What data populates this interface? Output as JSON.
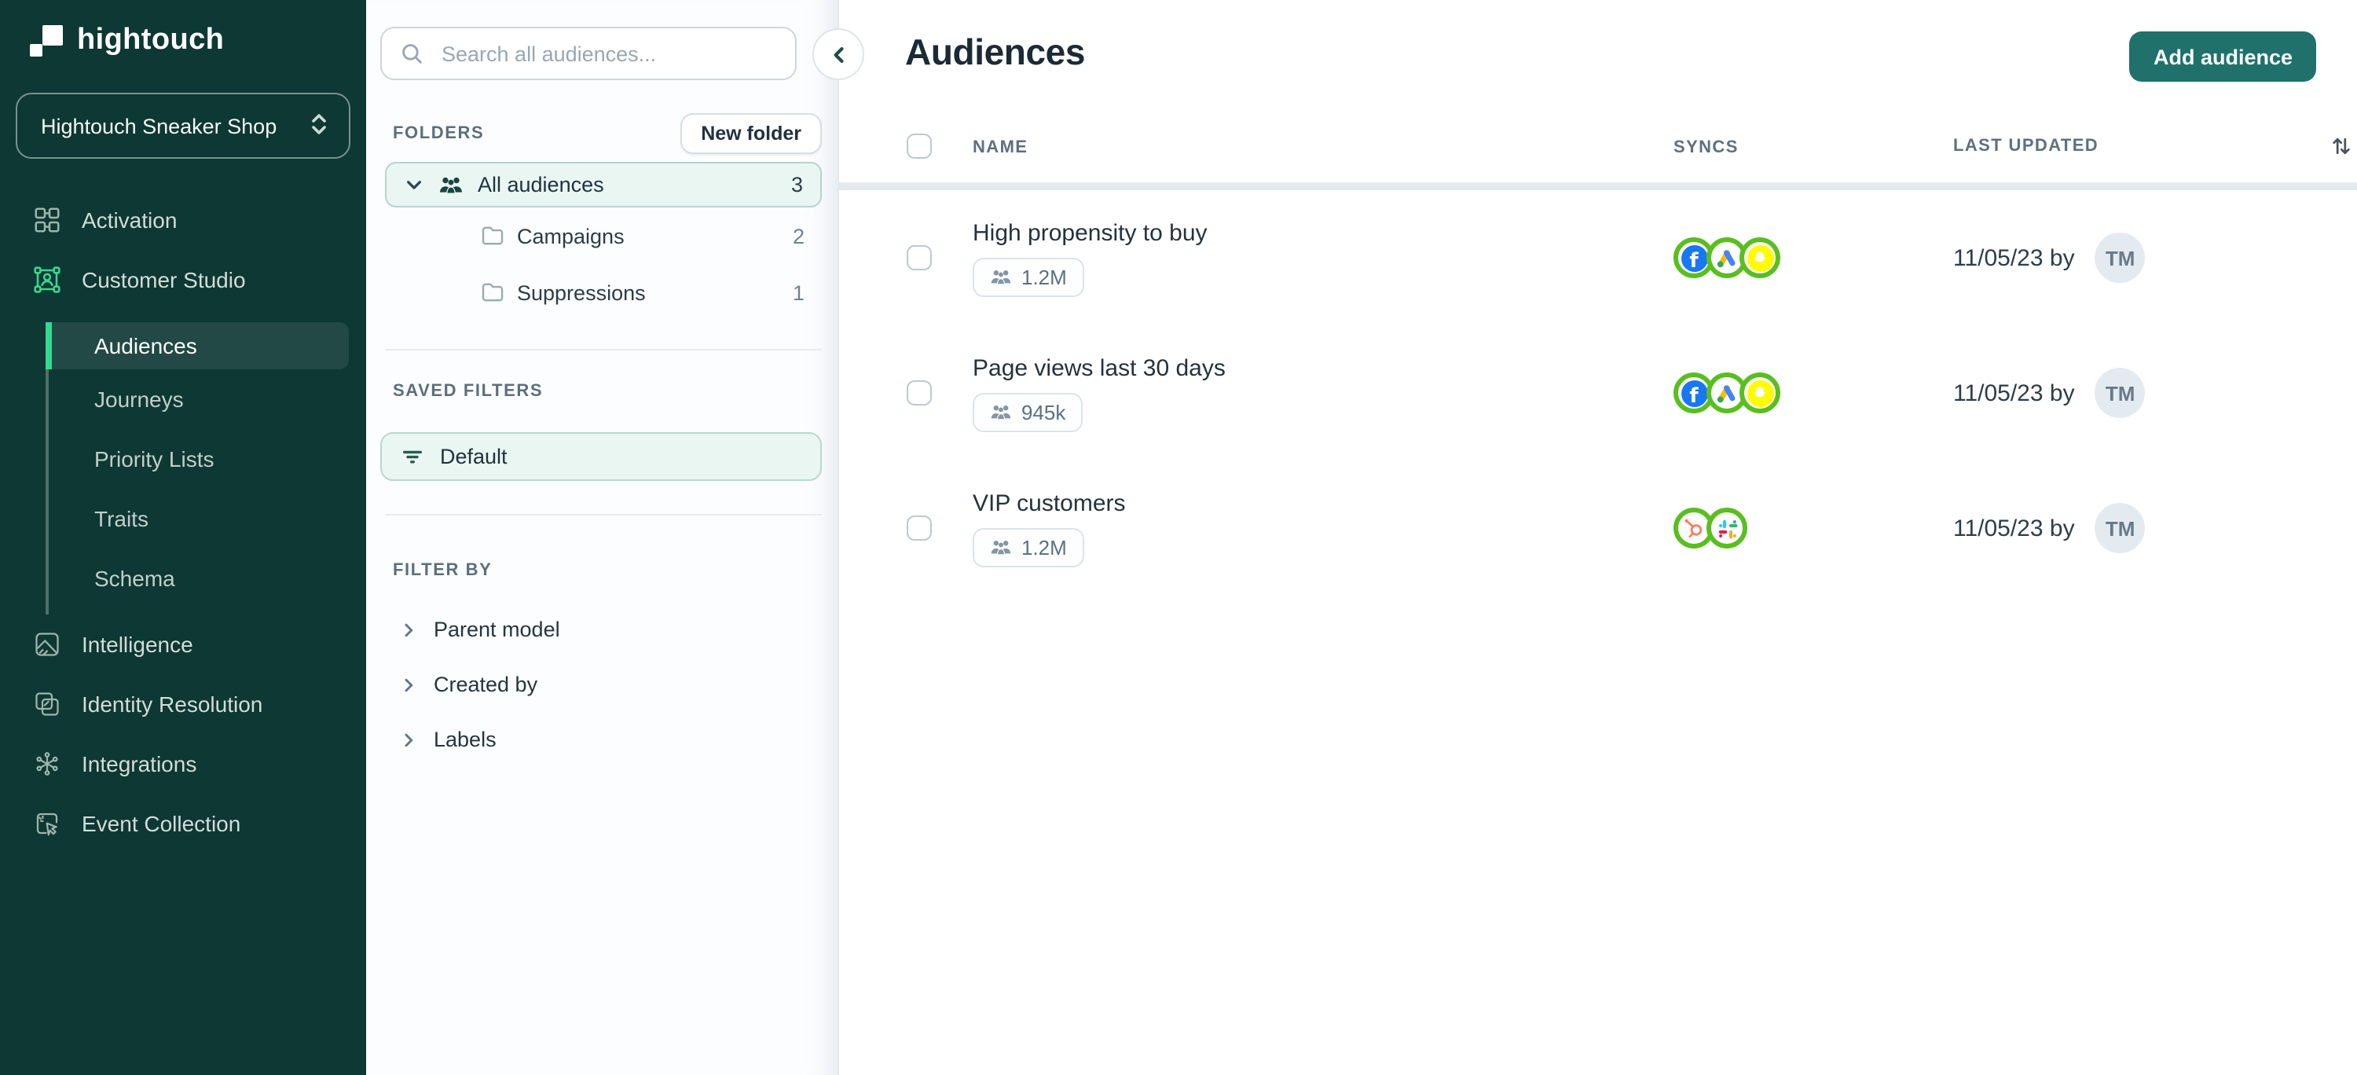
{
  "colors": {
    "sidebar_bg": "#0d3833",
    "accent_green": "#35d991",
    "button_teal": "#20716b",
    "ring_green": "#5abe20",
    "selected_tint": "#e9f6f2",
    "selected_border": "#b4d5cd"
  },
  "sidebar": {
    "logo_text": "hightouch",
    "workspace": {
      "name": "Hightouch Sneaker Shop"
    },
    "top_items": [
      {
        "label": "Activation",
        "icon": "activation-icon"
      },
      {
        "label": "Customer Studio",
        "icon": "customer-studio-icon"
      }
    ],
    "customer_studio_children": [
      {
        "label": "Audiences",
        "active": true
      },
      {
        "label": "Journeys"
      },
      {
        "label": "Priority Lists"
      },
      {
        "label": "Traits"
      },
      {
        "label": "Schema"
      }
    ],
    "bottom_items": [
      {
        "label": "Intelligence",
        "icon": "intelligence-icon"
      },
      {
        "label": "Identity Resolution",
        "icon": "identity-resolution-icon"
      },
      {
        "label": "Integrations",
        "icon": "integrations-icon"
      },
      {
        "label": "Event Collection",
        "icon": "event-collection-icon"
      }
    ]
  },
  "panel": {
    "search_placeholder": "Search all audiences...",
    "folders_label": "FOLDERS",
    "new_folder_button": "New folder",
    "folders": [
      {
        "name": "All audiences",
        "count": "3",
        "selected": true
      },
      {
        "name": "Campaigns",
        "count": "2"
      },
      {
        "name": "Suppressions",
        "count": "1"
      }
    ],
    "saved_filters_label": "SAVED FILTERS",
    "saved_filters": [
      {
        "name": "Default",
        "selected": true
      }
    ],
    "filter_by_label": "FILTER BY",
    "filter_groups": [
      {
        "label": "Parent model"
      },
      {
        "label": "Created by"
      },
      {
        "label": "Labels"
      }
    ]
  },
  "main": {
    "title": "Audiences",
    "add_button": "Add audience",
    "columns": {
      "name": "NAME",
      "syncs": "SYNCS",
      "last_updated": "LAST UPDATED"
    },
    "rows": [
      {
        "name": "High propensity to buy",
        "size": "1.2M",
        "syncs": [
          "facebook",
          "google-ads",
          "snapchat"
        ],
        "updated": "11/05/23 by",
        "avatar": "TM"
      },
      {
        "name": "Page views last 30 days",
        "size": "945k",
        "syncs": [
          "facebook",
          "google-ads",
          "snapchat"
        ],
        "updated": "11/05/23 by",
        "avatar": "TM"
      },
      {
        "name": "VIP customers",
        "size": "1.2M",
        "syncs": [
          "hubspot",
          "slack"
        ],
        "updated": "11/05/23 by",
        "avatar": "TM"
      }
    ]
  }
}
